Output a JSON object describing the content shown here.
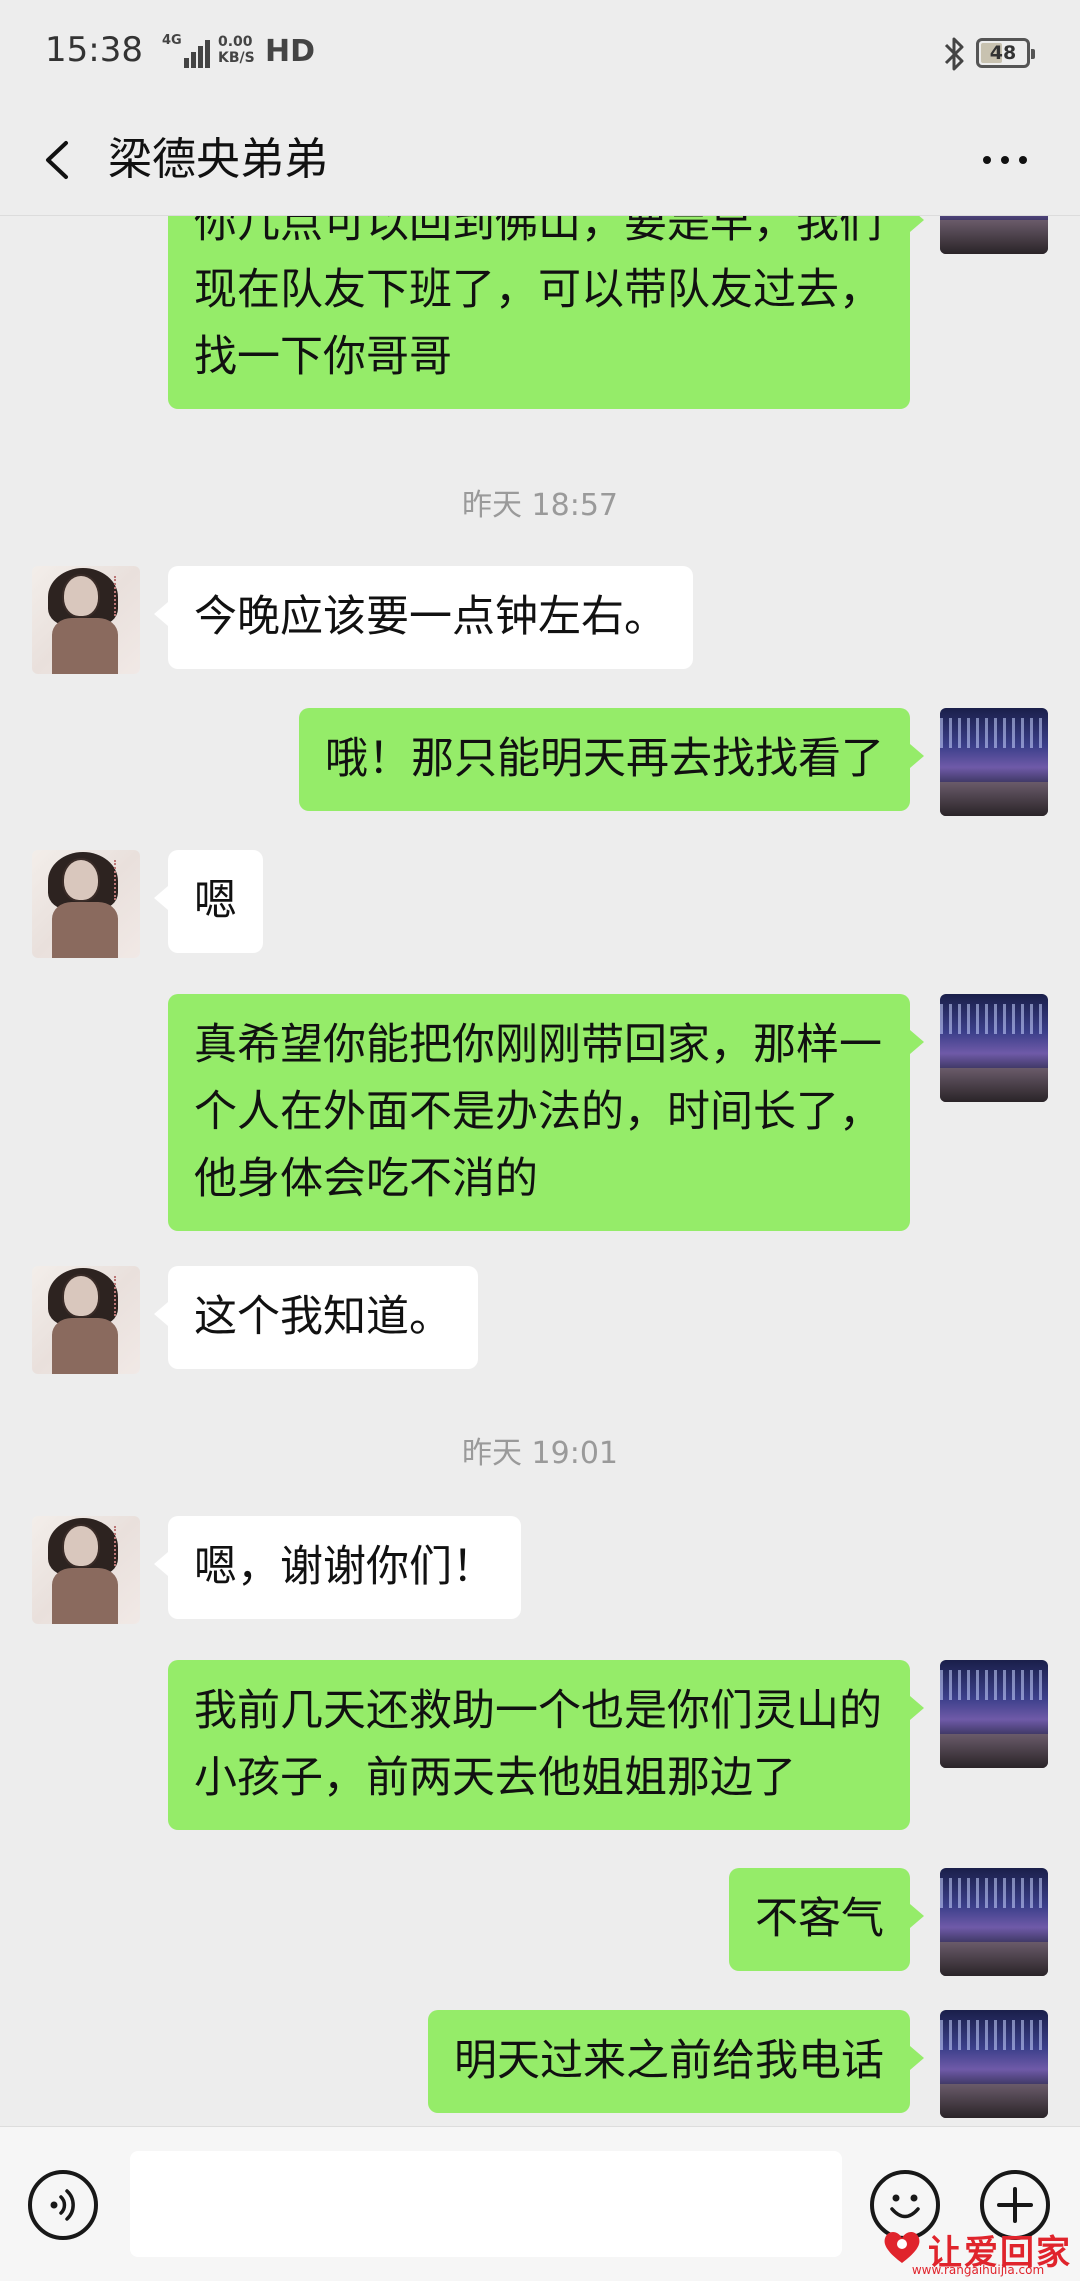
{
  "status_bar": {
    "time": "15:38",
    "network": "4G",
    "speed_value": "0.00",
    "speed_unit": "KB/S",
    "hd": "HD",
    "battery": "48",
    "battery_level": 0.48
  },
  "header": {
    "title": "梁德央弟弟",
    "back_icon": "chevron-left-icon",
    "more_icon": "ellipsis-icon"
  },
  "messages": [
    {
      "side": "out",
      "text": "你几点可以回到佛山，要是早，我们现在队友下班了，可以带队友过去，找一下你哥哥"
    },
    {
      "type": "time",
      "text": "昨天 18:57"
    },
    {
      "side": "in",
      "text": "今晚应该要一点钟左右。"
    },
    {
      "side": "out",
      "text": "哦！那只能明天再去找找看了"
    },
    {
      "side": "in",
      "text": "嗯"
    },
    {
      "side": "out",
      "text": "真希望你能把你刚刚带回家，那样一个人在外面不是办法的，时间长了，他身体会吃不消的"
    },
    {
      "side": "in",
      "text": "这个我知道。"
    },
    {
      "type": "time",
      "text": "昨天 19:01"
    },
    {
      "side": "in",
      "text": "嗯，谢谢你们！"
    },
    {
      "side": "out",
      "text": "我前几天还救助一个也是你们灵山的小孩子，前两天去他姐姐那边了"
    },
    {
      "side": "out",
      "text": "不客气"
    },
    {
      "side": "out",
      "text": "明天过来之前给我电话"
    }
  ],
  "input_bar": {
    "value": "",
    "voice_icon": "voice-icon",
    "emoji_icon": "emoji-icon",
    "plus_icon": "plus-icon"
  },
  "watermark": {
    "text": "让爱回家",
    "url": "www.rangaihuijia.com"
  },
  "colors": {
    "background": "#ededed",
    "outgoing_bubble": "#95ec69",
    "incoming_bubble": "#ffffff",
    "timestamp": "#9a9a9a",
    "watermark": "#e0242c"
  }
}
